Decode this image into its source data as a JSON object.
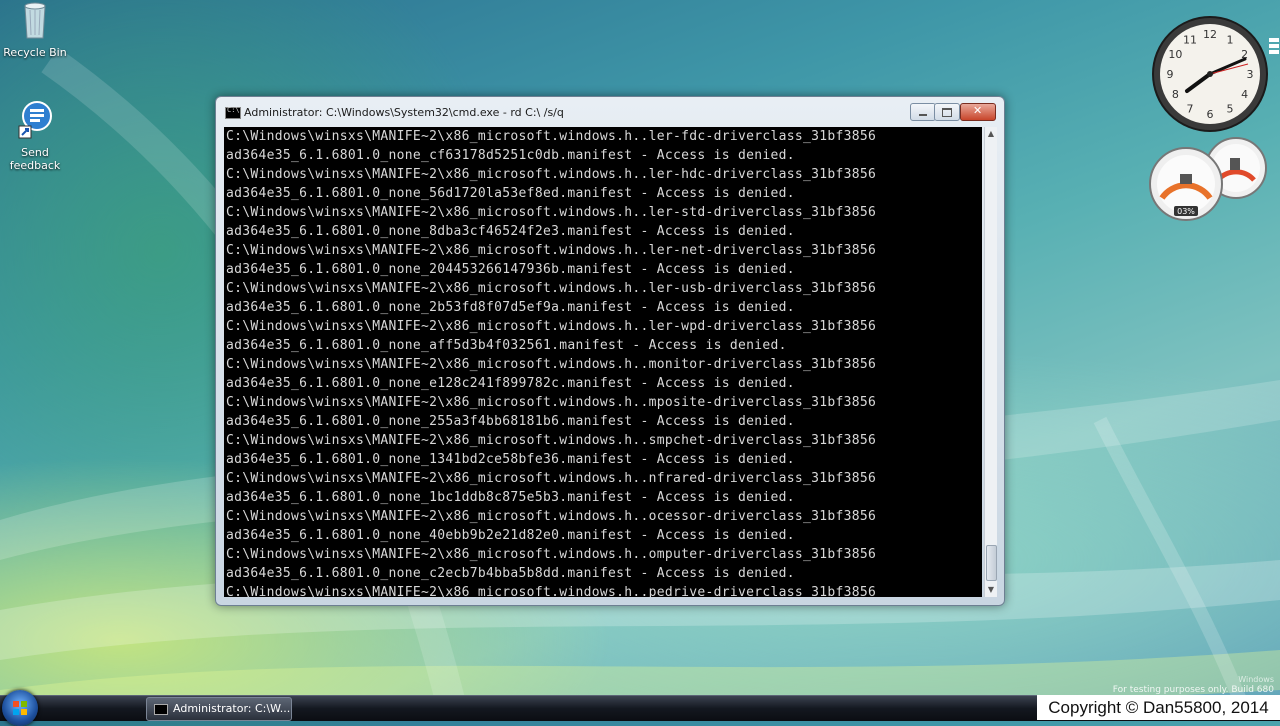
{
  "desktop": {
    "icons": [
      {
        "label": "Recycle Bin"
      },
      {
        "label": "Send\nfeedback"
      }
    ]
  },
  "cmd_window": {
    "title": "Administrator: C:\\Windows\\System32\\cmd.exe - rd  C:\\ /s/q",
    "lines": [
      "C:\\Windows\\winsxs\\MANIFE~2\\x86_microsoft.windows.h..ler-fdc-driverclass_31bf3856",
      "ad364e35_6.1.6801.0_none_cf63178d5251c0db.manifest - Access is denied.",
      "C:\\Windows\\winsxs\\MANIFE~2\\x86_microsoft.windows.h..ler-hdc-driverclass_31bf3856",
      "ad364e35_6.1.6801.0_none_56d1720la53ef8ed.manifest - Access is denied.",
      "C:\\Windows\\winsxs\\MANIFE~2\\x86_microsoft.windows.h..ler-std-driverclass_31bf3856",
      "ad364e35_6.1.6801.0_none_8dba3cf46524f2e3.manifest - Access is denied.",
      "C:\\Windows\\winsxs\\MANIFE~2\\x86_microsoft.windows.h..ler-net-driverclass_31bf3856",
      "ad364e35_6.1.6801.0_none_204453266147936b.manifest - Access is denied.",
      "C:\\Windows\\winsxs\\MANIFE~2\\x86_microsoft.windows.h..ler-usb-driverclass_31bf3856",
      "ad364e35_6.1.6801.0_none_2b53fd8f07d5ef9a.manifest - Access is denied.",
      "C:\\Windows\\winsxs\\MANIFE~2\\x86_microsoft.windows.h..ler-wpd-driverclass_31bf3856",
      "ad364e35_6.1.6801.0_none_aff5d3b4f032561.manifest - Access is denied.",
      "C:\\Windows\\winsxs\\MANIFE~2\\x86_microsoft.windows.h..monitor-driverclass_31bf3856",
      "ad364e35_6.1.6801.0_none_e128c241f899782c.manifest - Access is denied.",
      "C:\\Windows\\winsxs\\MANIFE~2\\x86_microsoft.windows.h..mposite-driverclass_31bf3856",
      "ad364e35_6.1.6801.0_none_255a3f4bb68181b6.manifest - Access is denied.",
      "C:\\Windows\\winsxs\\MANIFE~2\\x86_microsoft.windows.h..smpchet-driverclass_31bf3856",
      "ad364e35_6.1.6801.0_none_1341bd2ce58bfe36.manifest - Access is denied.",
      "C:\\Windows\\winsxs\\MANIFE~2\\x86_microsoft.windows.h..nfrared-driverclass_31bf3856",
      "ad364e35_6.1.6801.0_none_1bc1ddb8c875e5b3.manifest - Access is denied.",
      "C:\\Windows\\winsxs\\MANIFE~2\\x86_microsoft.windows.h..ocessor-driverclass_31bf3856",
      "ad364e35_6.1.6801.0_none_40ebb9b2e21d82e0.manifest - Access is denied.",
      "C:\\Windows\\winsxs\\MANIFE~2\\x86_microsoft.windows.h..omputer-driverclass_31bf3856",
      "ad364e35_6.1.6801.0_none_c2ecb7b4bba5b8dd.manifest - Access is denied.",
      "C:\\Windows\\winsxs\\MANIFE~2\\x86_microsoft.windows.h..pedrive-driverclass_31bf3856"
    ]
  },
  "gadgets": {
    "clock_numbers": [
      "12",
      "1",
      "2",
      "3",
      "4",
      "5",
      "6",
      "7",
      "8",
      "9",
      "10",
      "11"
    ],
    "cpu_percent": "03%"
  },
  "watermark": {
    "line1": "Windows",
    "line2": "For testing purposes only. Build 680"
  },
  "taskbar": {
    "cmd_task_label": "Administrator: C:\\W..."
  },
  "copyright": "Copyright © Dan55800, 2014",
  "colors": {
    "console_bg": "#000000",
    "console_text": "#d8d8d8",
    "close_button": "#c8452a"
  }
}
